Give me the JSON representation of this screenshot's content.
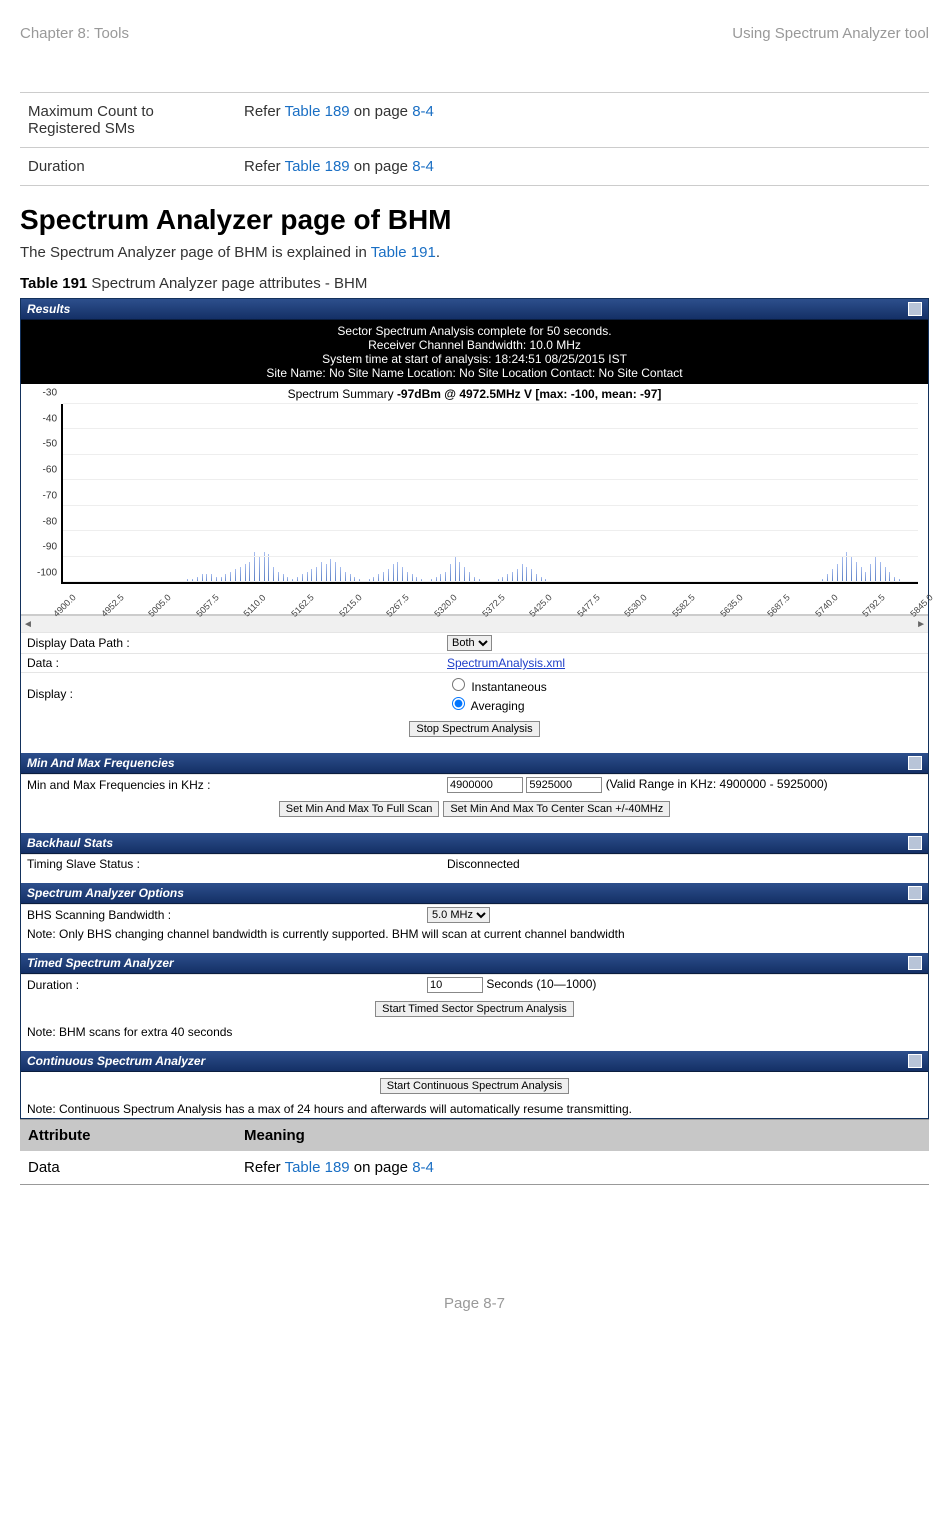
{
  "header": {
    "left": "Chapter 8:  Tools",
    "right": "Using Spectrum Analyzer tool"
  },
  "top_table": [
    {
      "attr": "Maximum Count to Registered SMs",
      "prefix": "Refer ",
      "link": "Table 189",
      "mid": " on page ",
      "page": "8-4"
    },
    {
      "attr": "Duration",
      "prefix": "Refer ",
      "link": "Table 189",
      "mid": " on page ",
      "page": "8-4"
    }
  ],
  "h1": "Spectrum Analyzer page of BHM",
  "para": {
    "pre": "The Spectrum Analyzer page of BHM is explained in ",
    "link": "Table 191",
    "post": "."
  },
  "caption": {
    "bold": "Table 191",
    "rest": " Spectrum Analyzer page attributes - BHM"
  },
  "results": {
    "title": "Results",
    "status": [
      "Sector Spectrum Analysis complete for 50 seconds.",
      "Receiver Channel Bandwidth: 10.0 MHz",
      "System time at start of analysis: 18:24:51 08/25/2015 IST",
      "Site Name: No Site Name  Location: No Site Location  Contact: No Site Contact"
    ],
    "summary": {
      "pre": "Spectrum Summary ",
      "bold": "-97dBm @ 4972.5MHz V [max: -100, mean: -97]"
    }
  },
  "chart_data": {
    "type": "bar",
    "ylabel": "dBm",
    "ylim": [
      -100,
      -30
    ],
    "yticks": [
      -30,
      -40,
      -50,
      -60,
      -70,
      -80,
      -90,
      -100
    ],
    "xlim": [
      4900,
      5845
    ],
    "xticks": [
      "4900.0",
      "4952.5",
      "5005.0",
      "5057.5",
      "5110.0",
      "5162.5",
      "5215.0",
      "5267.5",
      "5320.0",
      "5372.5",
      "5425.0",
      "5477.5",
      "5530.0",
      "5582.5",
      "5635.0",
      "5687.5",
      "5740.0",
      "5792.5",
      "5845.0"
    ],
    "series": [
      {
        "name": "max",
        "values_dbm": [
          -100,
          -100,
          -100,
          -100,
          -100,
          -100,
          -100,
          -100,
          -100,
          -100,
          -100,
          -100,
          -100,
          -100,
          -100,
          -100,
          -100,
          -100,
          -100,
          -100,
          -100,
          -100,
          -100,
          -100,
          -100,
          -100,
          -99,
          -99,
          -98,
          -97,
          -97,
          -97,
          -98,
          -98,
          -97,
          -96,
          -95,
          -94,
          -93,
          -92,
          -88,
          -90,
          -88,
          -89,
          -94,
          -96,
          -97,
          -98,
          -99,
          -98,
          -97,
          -96,
          -95,
          -94,
          -92,
          -93,
          -91,
          -92,
          -94,
          -96,
          -97,
          -98,
          -99,
          -100,
          -99,
          -98,
          -97,
          -96,
          -95,
          -93,
          -92,
          -94,
          -96,
          -97,
          -98,
          -99,
          -100,
          -99,
          -98,
          -97,
          -96,
          -93,
          -90,
          -92,
          -94,
          -96,
          -98,
          -99,
          -100,
          -100,
          -100,
          -99,
          -98,
          -97,
          -96,
          -95,
          -93,
          -94,
          -95,
          -97,
          -98,
          -99,
          -100,
          -100,
          -100,
          -100,
          -100,
          -100,
          -100,
          -100,
          -100,
          -100,
          -100,
          -100,
          -100,
          -100,
          -100,
          -100,
          -100,
          -100,
          -100,
          -100,
          -100,
          -100,
          -100,
          -100,
          -100,
          -100,
          -100,
          -100,
          -100,
          -100,
          -100,
          -100,
          -100,
          -100,
          -100,
          -100,
          -100,
          -100,
          -100,
          -100,
          -100,
          -100,
          -100,
          -100,
          -100,
          -100,
          -100,
          -100,
          -100,
          -100,
          -100,
          -100,
          -100,
          -100,
          -100,
          -100,
          -100,
          -99,
          -97,
          -95,
          -93,
          -90,
          -88,
          -90,
          -92,
          -94,
          -96,
          -93,
          -90,
          -92,
          -94,
          -96,
          -98,
          -99,
          -100,
          -100,
          -100,
          -100
        ]
      }
    ]
  },
  "rows": {
    "display_data_path": {
      "label": "Display Data Path :",
      "value": "Both"
    },
    "data": {
      "label": "Data :",
      "link": "SpectrumAnalysis.xml"
    },
    "display": {
      "label": "Display :",
      "opt1": "Instantaneous",
      "opt2": "Averaging",
      "selected": "Averaging"
    },
    "stop_btn": "Stop Spectrum Analysis"
  },
  "minmax": {
    "title": "Min And Max Frequencies",
    "label": "Min and Max Frequencies in KHz :",
    "min": "4900000",
    "max": "5925000",
    "range": "(Valid Range in KHz: 4900000 - 5925000)",
    "btn1": "Set Min And Max To Full Scan",
    "btn2": "Set Min And Max To Center Scan +/-40MHz"
  },
  "backhaul": {
    "title": "Backhaul Stats",
    "label": "Timing Slave Status :",
    "value": "Disconnected"
  },
  "options": {
    "title": "Spectrum Analyzer Options",
    "label": "BHS Scanning Bandwidth :",
    "value": "5.0 MHz",
    "note": "Note: Only BHS changing channel bandwidth is currently supported. BHM will scan at current channel bandwidth"
  },
  "timed": {
    "title": "Timed Spectrum Analyzer",
    "label": "Duration :",
    "value": "10",
    "suffix": "Seconds (10—1000)",
    "btn": "Start Timed Sector Spectrum Analysis",
    "note": "Note: BHM scans for extra 40 seconds"
  },
  "cont": {
    "title": "Continuous Spectrum Analyzer",
    "btn": "Start Continuous Spectrum Analysis",
    "note": "Note: Continuous Spectrum Analysis has a max of 24 hours and afterwards will automatically resume transmitting."
  },
  "attr_table": {
    "h1": "Attribute",
    "h2": "Meaning",
    "row": {
      "attr": "Data",
      "prefix": "Refer ",
      "link": "Table 189",
      "mid": " on page ",
      "page": "8-4"
    }
  },
  "footer": "Page 8-7"
}
